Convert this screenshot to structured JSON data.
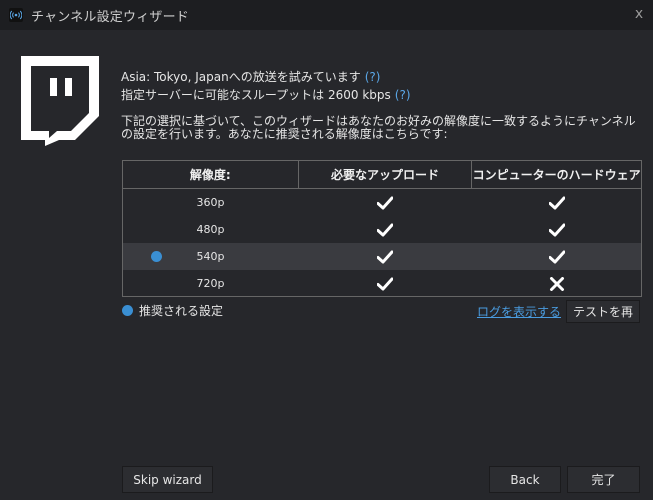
{
  "window": {
    "title": "チャンネル設定ウィザード",
    "close_symbol": "x"
  },
  "info": {
    "line1": "Asia: Tokyo, Japanへの放送を試みています",
    "line2": "指定サーバーに可能なスループットは  2600 kbps",
    "help": "(?)",
    "description": "下記の選択に基づいて、このウィザードはあなたのお好みの解像度に一致するようにチャンネルの設定を行います。あなたに推奨される解像度はこちらです:"
  },
  "table": {
    "headers": [
      "解像度:",
      "必要なアップロード",
      "コンピューターのハードウェア"
    ],
    "rows": [
      {
        "resolution": "360p",
        "upload": "check",
        "hardware": "check",
        "recommended": false
      },
      {
        "resolution": "480p",
        "upload": "check",
        "hardware": "check",
        "recommended": false
      },
      {
        "resolution": "540p",
        "upload": "check",
        "hardware": "check",
        "recommended": true
      },
      {
        "resolution": "720p",
        "upload": "check",
        "hardware": "cross",
        "recommended": false
      }
    ]
  },
  "legend": {
    "label": "推奨される設定"
  },
  "links": {
    "show_log": "ログを表示する"
  },
  "buttons": {
    "retest": "テストを再",
    "skip": "Skip wizard",
    "back": "Back",
    "finish": "完了"
  },
  "colors": {
    "background": "#26272b",
    "accent_dot": "#3a8fd3",
    "link": "#4a9ce0"
  },
  "icons": {
    "app": "broadcast-icon",
    "logo": "twitch-logo",
    "check": "check-icon",
    "cross": "cross-icon"
  }
}
